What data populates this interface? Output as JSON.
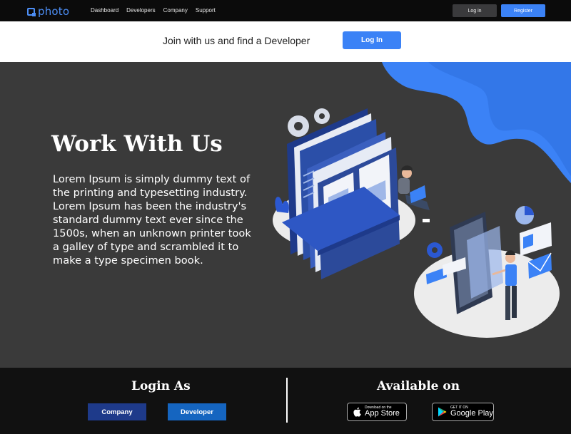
{
  "nav": {
    "logo": "photo",
    "links": [
      "Dashboard",
      "Developers",
      "Company",
      "Support"
    ],
    "login": "Log in",
    "register": "Register"
  },
  "join": {
    "text": "Join with us and find a Developer",
    "button": "Log In"
  },
  "hero": {
    "title": "Work With Us",
    "body": "Lorem Ipsum is simply dummy text of the printing and typesetting industry. Lorem Ipsum has been the industry's standard dummy text ever since the 1500s, when an unknown printer took a galley of type and scrambled it to make a type specimen book."
  },
  "footer": {
    "login_heading": "Login As",
    "login_buttons": [
      "Company",
      "Developer"
    ],
    "available_heading": "Available on",
    "app_store": {
      "small": "Download on the",
      "big": "App Store"
    },
    "google_play": {
      "small": "GET IT ON",
      "big": "Google Play"
    }
  },
  "colors": {
    "accent": "#3b82f6",
    "nav_bg": "#0b0b0b",
    "hero_bg": "#3a3a3a",
    "company_button": "#1e3a8a",
    "developer_button": "#1565c0"
  },
  "icons": [
    "logo-icon",
    "apple-icon",
    "google-play-icon"
  ]
}
